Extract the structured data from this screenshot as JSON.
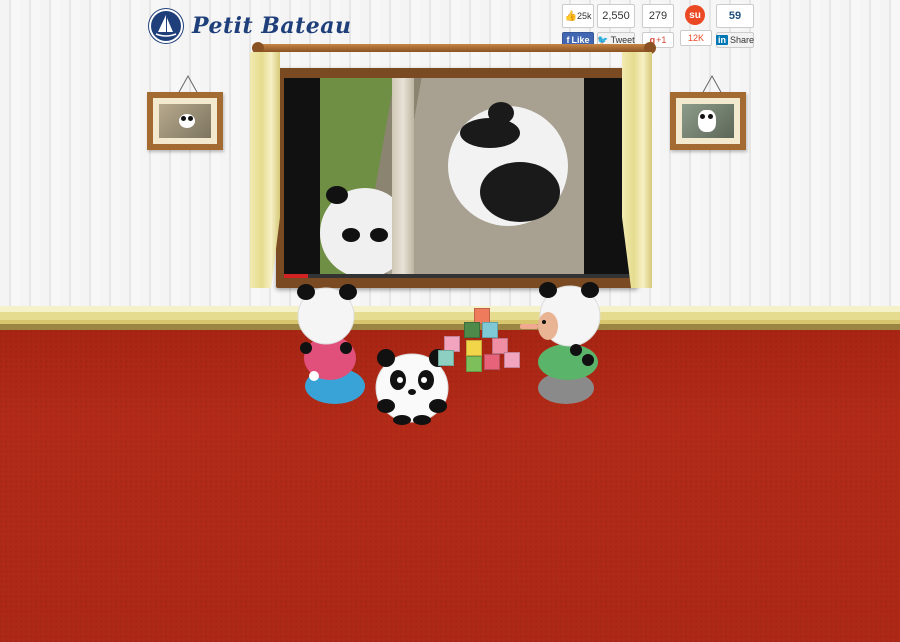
{
  "brand": {
    "name": "Petit Bateau",
    "mark_text": "PETIT BATEAU",
    "color": "#1f3f7a"
  },
  "social": {
    "fb_like_count": "25k",
    "fb_like_label": "Like",
    "twitter_count": "2,550",
    "tweet_label": "Tweet",
    "gplus_count": "279",
    "gplus_label": "+1",
    "stumble_count": "12K",
    "linkedin_count": "59",
    "linkedin_label": "Share"
  },
  "video": {
    "progress": 0.07,
    "accent": "#d22222"
  },
  "colors": {
    "wall": "#f4f4f4",
    "carpet": "#b52a1a",
    "moulding": "#e6dc8f",
    "frame": "#a36a32"
  }
}
